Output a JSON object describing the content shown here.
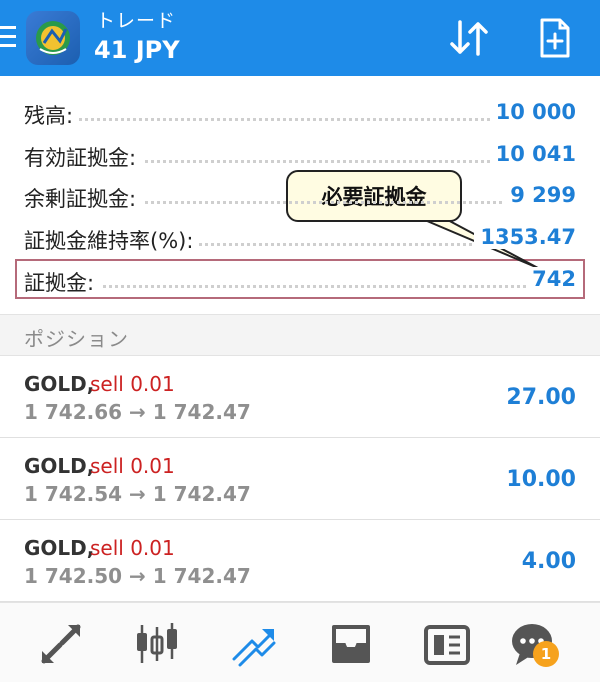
{
  "header": {
    "title": "トレード",
    "subtitle": "41 JPY",
    "color": "#1e8be8"
  },
  "account": {
    "rows": [
      {
        "label": "残高:",
        "value": "10 000"
      },
      {
        "label": "有効証拠金:",
        "value": "10 041"
      },
      {
        "label": "余剰証拠金:",
        "value": "9 299"
      },
      {
        "label": "証拠金維持率(%):",
        "value": "1353.47"
      },
      {
        "label": "証拠金:",
        "value": "742"
      }
    ]
  },
  "callout": {
    "text": "必要証拠金"
  },
  "positions": {
    "section_label": "ポジション",
    "items": [
      {
        "symbol": "GOLD,",
        "side": "sell 0.01",
        "prices": "1 742.66 → 1 742.47",
        "profit": "27.00"
      },
      {
        "symbol": "GOLD,",
        "side": "sell 0.01",
        "prices": "1 742.54 → 1 742.47",
        "profit": "10.00"
      },
      {
        "symbol": "GOLD,",
        "side": "sell 0.01",
        "prices": "1 742.50 → 1 742.47",
        "profit": "4.00"
      }
    ]
  },
  "nav": {
    "items": [
      "quotes-icon",
      "chart-icon",
      "trade-icon",
      "history-icon",
      "news-icon",
      "chat-icon"
    ],
    "active": "trade-icon",
    "chat_badge": "1"
  },
  "colors": {
    "accent": "#1e8be8",
    "value": "#1e7fd6",
    "sell": "#cc2222",
    "badge": "#f6a21d"
  }
}
